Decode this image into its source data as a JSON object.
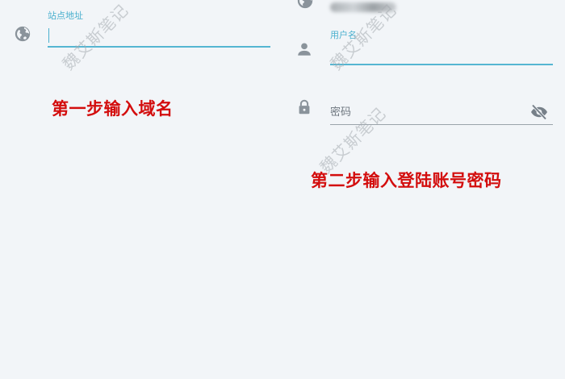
{
  "site_field": {
    "label": "站点地址",
    "value": "",
    "icon": "globe-icon"
  },
  "username_field": {
    "label": "用户名",
    "value": "",
    "icon": "user-icon",
    "top_icon": "globe-icon"
  },
  "password_field": {
    "placeholder": "密码",
    "icon": "lock-icon",
    "toggle_icon": "eye-off-icon"
  },
  "annotations": {
    "step1": "第一步输入域名",
    "step2": "第二步输入登陆账号密码"
  },
  "watermark": {
    "text": "魏艾斯笔记"
  },
  "colors": {
    "accent": "#55b6d2",
    "annotation": "#d30d0d",
    "icon": "#8a939b",
    "background": "#f2f5f8"
  }
}
